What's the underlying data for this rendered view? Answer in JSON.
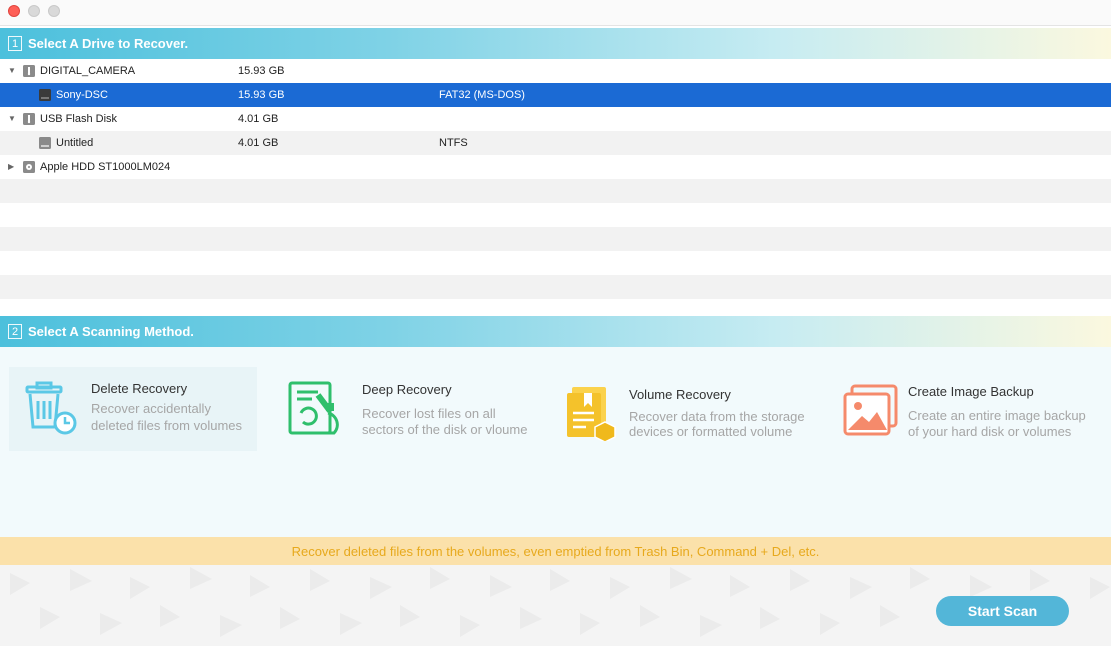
{
  "section1": {
    "number": "1",
    "title": "Select A Drive to Recover."
  },
  "drives": [
    {
      "name": "DIGITAL_CAMERA",
      "size": "15.93 GB",
      "fs": ""
    },
    {
      "name": "Sony-DSC",
      "size": "15.93 GB",
      "fs": "FAT32 (MS-DOS)"
    },
    {
      "name": "USB Flash Disk",
      "size": "4.01 GB",
      "fs": ""
    },
    {
      "name": "Untitled",
      "size": "4.01 GB",
      "fs": "NTFS"
    },
    {
      "name": "Apple HDD ST1000LM024",
      "size": "",
      "fs": ""
    }
  ],
  "section2": {
    "number": "2",
    "title": "Select A Scanning Method."
  },
  "methods": [
    {
      "title": "Delete Recovery",
      "desc1": "Recover accidentally",
      "desc2": "deleted files from volumes",
      "icon": "trash-clock-icon",
      "color": "#5bc8e6"
    },
    {
      "title": "Deep Recovery",
      "desc1": "Recover lost files on all",
      "desc2": "sectors of the disk or vloume",
      "icon": "microscope-icon",
      "color": "#2fbf6c"
    },
    {
      "title": "Volume Recovery",
      "desc1": "Recover data from the storage",
      "desc2": "devices or formatted volume",
      "icon": "document-box-icon",
      "color": "#f4c22b"
    },
    {
      "title": "Create Image Backup",
      "desc1": "Create an entire image backup",
      "desc2": "of your hard disk or volumes",
      "icon": "image-icon",
      "color": "#f58a6b"
    }
  ],
  "hint": "Recover deleted files from the volumes, even emptied from Trash Bin, Command + Del, etc.",
  "start_button": "Start Scan",
  "colors": {
    "accent": "#53b6d8",
    "selection": "#1b6ad4",
    "hint_text": "#e7a91d",
    "hint_bg": "#fbe1aa"
  }
}
